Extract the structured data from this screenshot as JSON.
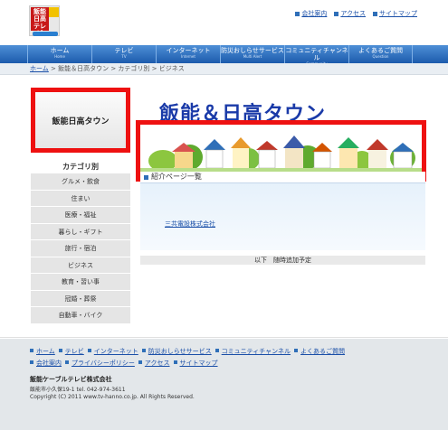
{
  "logo_text": "飯能日高テレビ",
  "top_links": [
    "会社案内",
    "アクセス",
    "サイトマップ"
  ],
  "nav": [
    {
      "label": "ホーム",
      "sub": "Home"
    },
    {
      "label": "テレビ",
      "sub": "TV"
    },
    {
      "label": "インターネット",
      "sub": "Internet"
    },
    {
      "label": "防災おしらせサービス",
      "sub": "Multi Alert"
    },
    {
      "label": "コミュニティチャンネル",
      "sub": "Community"
    },
    {
      "label": "よくあるご質問",
      "sub": "Question"
    }
  ],
  "breadcrumb": {
    "home": "ホーム",
    "rest": " > 飯能＆日高タウン > カテゴリ別 > ビジネス"
  },
  "sidebar": {
    "banner": "飯能日高タウン",
    "category_head": "カテゴリ別",
    "categories": [
      "グルメ・飲食",
      "住まい",
      "医療・福祉",
      "暮らし・ギフト",
      "旅行・宿泊",
      "ビジネス",
      "教育・習い事",
      "冠婚・葬祭",
      "自動車・バイク"
    ]
  },
  "main": {
    "title": "飯能＆日高タウン",
    "intro_head": "紹介ページ一覧",
    "company_link": "三共電設株式会社",
    "note": "以下　随時追加予定"
  },
  "footer": {
    "row1": [
      "ホーム",
      "テレビ",
      "インターネット",
      "防災おしらせサービス",
      "コミュニティチャンネル",
      "よくあるご質問"
    ],
    "row2": [
      "会社案内",
      "プライバシーポリシー",
      "アクセス",
      "サイトマップ"
    ],
    "company": "飯能ケーブルテレビ株式会社",
    "address": "飯能市小久保19-1  tel. 042-974-3611",
    "copyright": "Copyright (C) 2011 www.tv-hanno.co.jp. All Rights Reserved."
  },
  "colors": {
    "nav": "#1c5bad",
    "highlight": "#ee1111",
    "title": "#1a3aa8"
  }
}
